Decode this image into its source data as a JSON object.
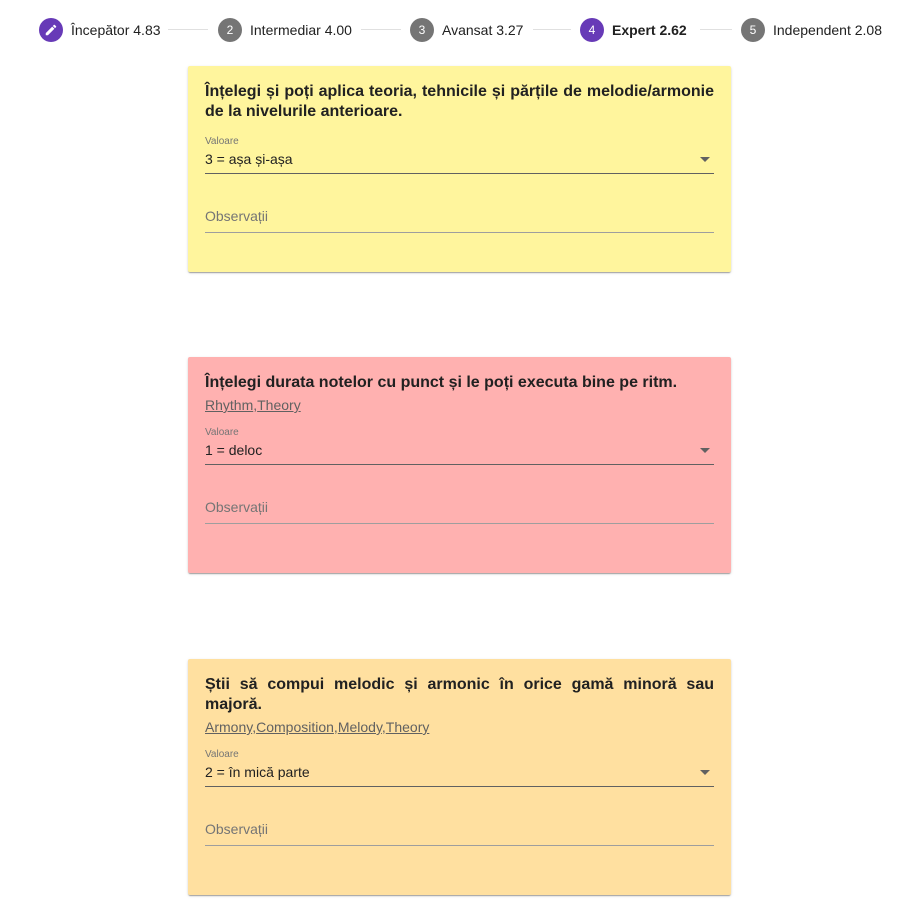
{
  "stepper": {
    "steps": [
      {
        "number": "",
        "label": "Începător 4.83",
        "icon": "pencil-icon",
        "active": true
      },
      {
        "number": "2",
        "label": "Intermediar 4.00",
        "active": false
      },
      {
        "number": "3",
        "label": "Avansat 3.27",
        "active": false
      },
      {
        "number": "4",
        "label": "Expert 2.62",
        "active": true
      },
      {
        "number": "5",
        "label": "Independent 2.08",
        "active": false
      }
    ]
  },
  "colors": {
    "accent": "#673ab7",
    "step_inactive": "#757575",
    "card_yellow": "#fff59d",
    "card_red": "#ffb1b0",
    "card_orange": "#ffe0a0"
  },
  "cards": [
    {
      "question": "Înțelegi și poți aplica teoria, tehnicile și părțile de melodie/armonie de la nivelurile anterioare.",
      "tags": [],
      "value_label": "Valoare",
      "value": "3 = așa și-așa",
      "notes_placeholder": "Observații"
    },
    {
      "question": "Înțelegi durata notelor cu punct și le poți executa bine pe ritm.",
      "tags": [
        "Rhythm",
        "Theory"
      ],
      "value_label": "Valoare",
      "value": "1 = deloc",
      "notes_placeholder": "Observații"
    },
    {
      "question": "Știi să compui melodic și armonic în orice gamă minoră sau majoră.",
      "tags": [
        "Armony",
        "Composition",
        "Melody",
        "Theory"
      ],
      "value_label": "Valoare",
      "value": "2 = în mică parte",
      "notes_placeholder": "Observații"
    }
  ]
}
